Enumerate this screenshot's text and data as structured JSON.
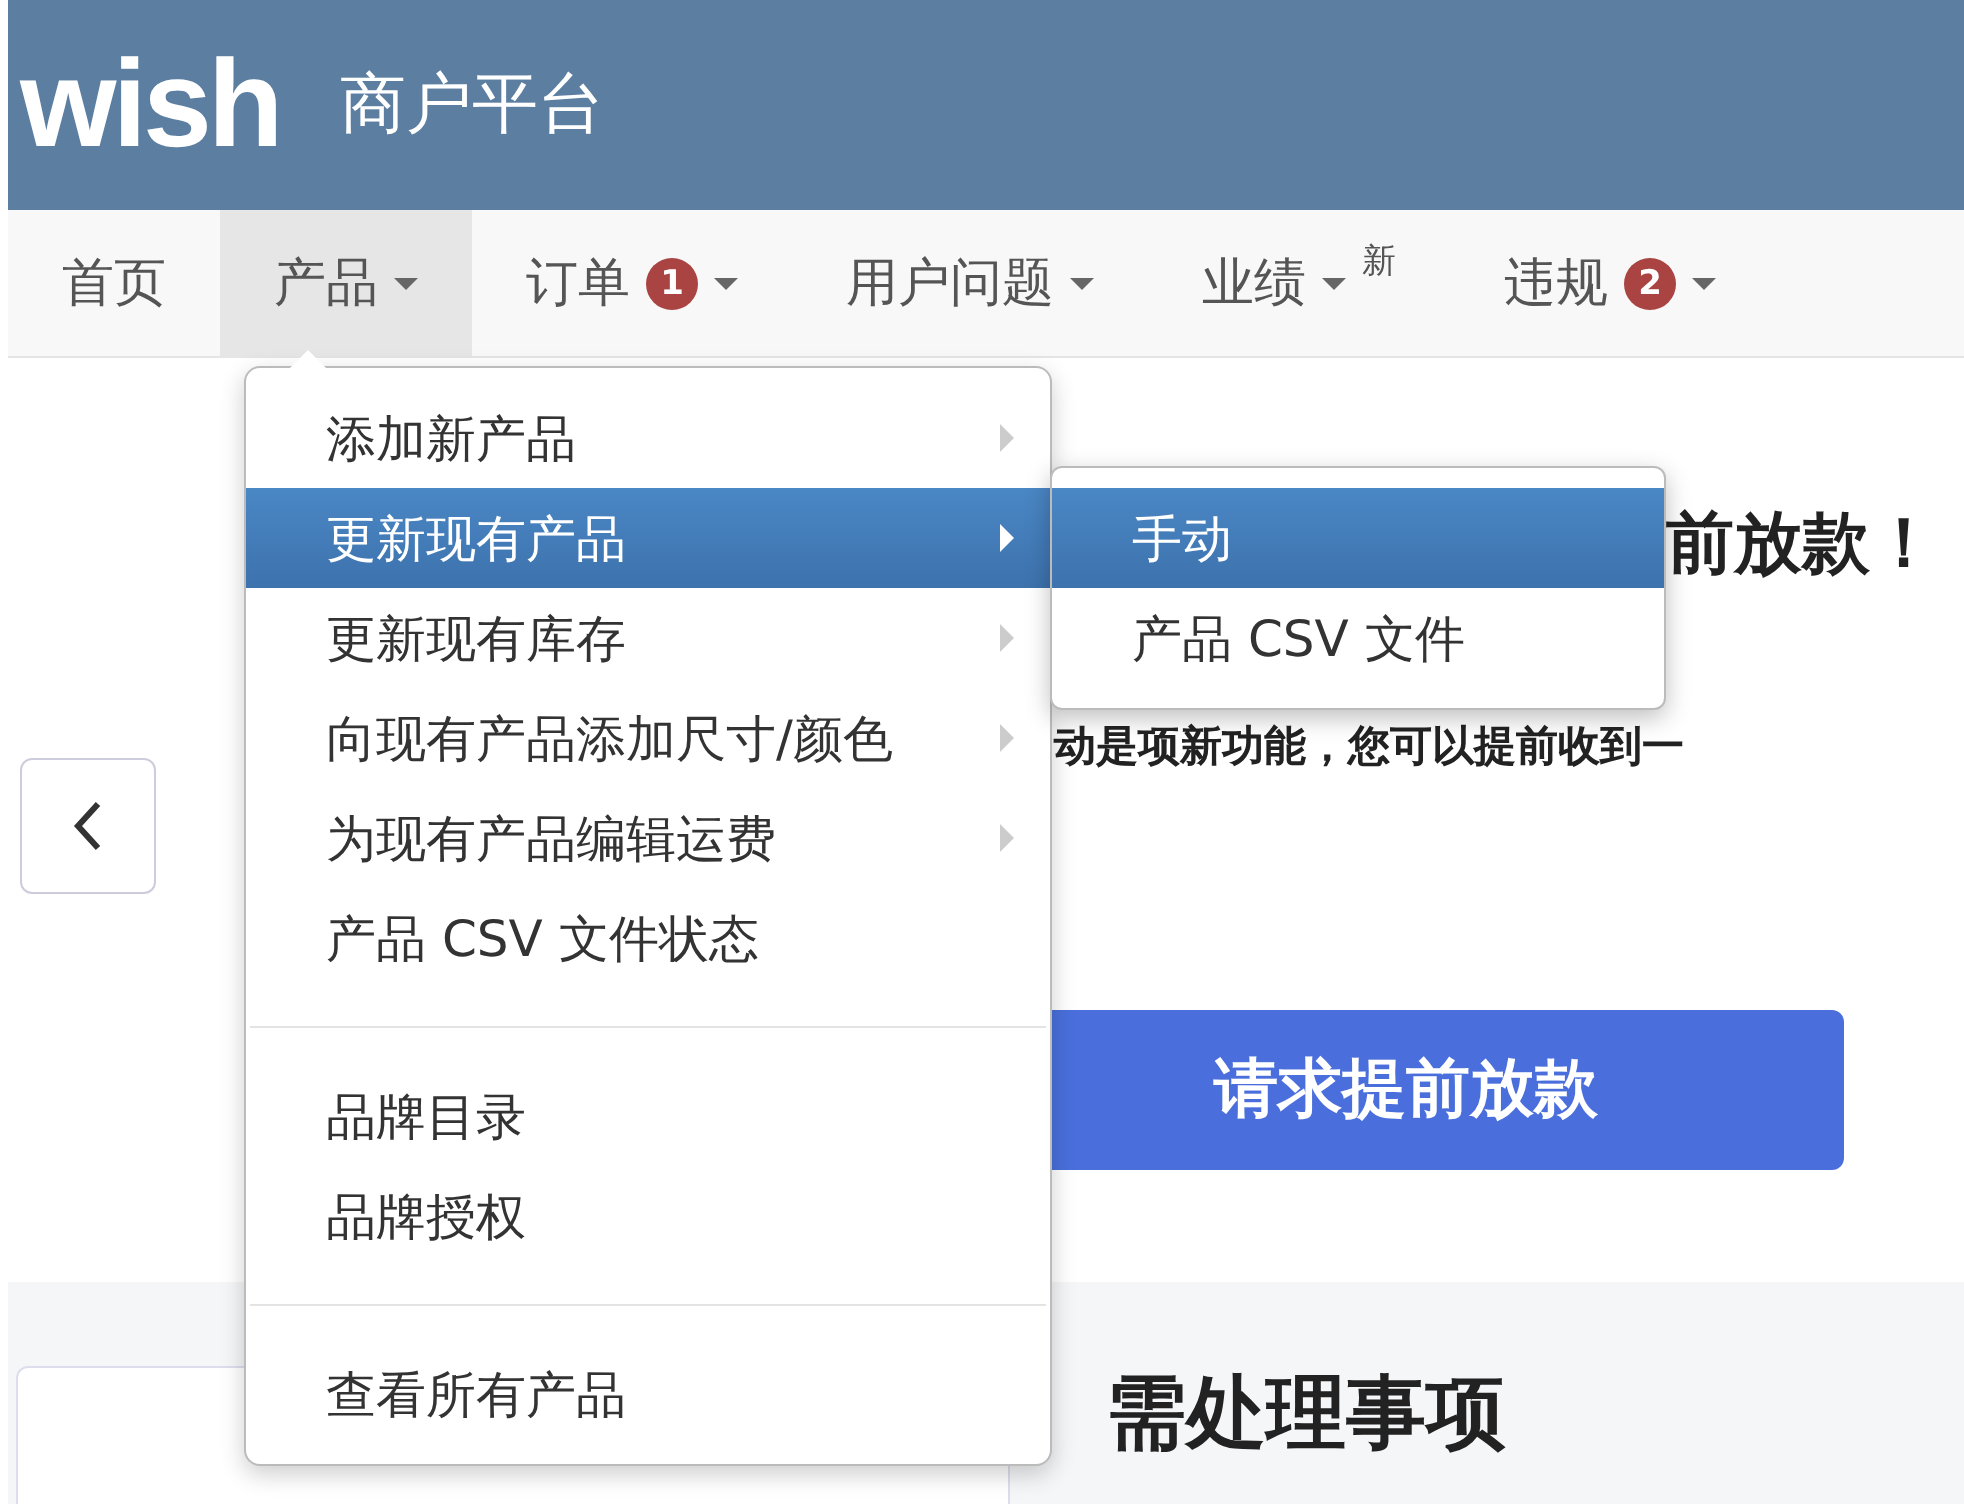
{
  "header": {
    "logo": "wish",
    "title": "商户平台"
  },
  "nav": [
    {
      "label": "首页",
      "selected": false,
      "caret": false
    },
    {
      "label": "产品",
      "selected": true,
      "caret": true
    },
    {
      "label": "订单",
      "selected": false,
      "caret": true,
      "badge": "1"
    },
    {
      "label": "用户问题",
      "selected": false,
      "caret": true
    },
    {
      "label": "业绩",
      "selected": false,
      "caret": true,
      "superscript": "新"
    },
    {
      "label": "违规",
      "selected": false,
      "caret": true,
      "badge": "2"
    }
  ],
  "dropdown": {
    "groups": [
      [
        {
          "label": "添加新产品",
          "submenu": true,
          "selected": false
        },
        {
          "label": "更新现有产品",
          "submenu": true,
          "selected": true
        },
        {
          "label": "更新现有库存",
          "submenu": true,
          "selected": false
        },
        {
          "label": "向现有产品添加尺寸/颜色",
          "submenu": true,
          "selected": false
        },
        {
          "label": "为现有产品编辑运费",
          "submenu": true,
          "selected": false
        },
        {
          "label": "产品 CSV 文件状态",
          "submenu": false,
          "selected": false
        }
      ],
      [
        {
          "label": "品牌目录",
          "submenu": false,
          "selected": false
        },
        {
          "label": "品牌授权",
          "submenu": false,
          "selected": false
        }
      ],
      [
        {
          "label": "查看所有产品",
          "submenu": false,
          "selected": false
        }
      ]
    ]
  },
  "submenu": [
    {
      "label": "手动",
      "selected": true
    },
    {
      "label": "产品 CSV 文件",
      "selected": false
    }
  ],
  "banner": {
    "heading": "前放款！",
    "text": "动是项新功能，您可以提前收到一",
    "button": "请求提前放款"
  },
  "todo": {
    "heading": "需处理事项"
  }
}
